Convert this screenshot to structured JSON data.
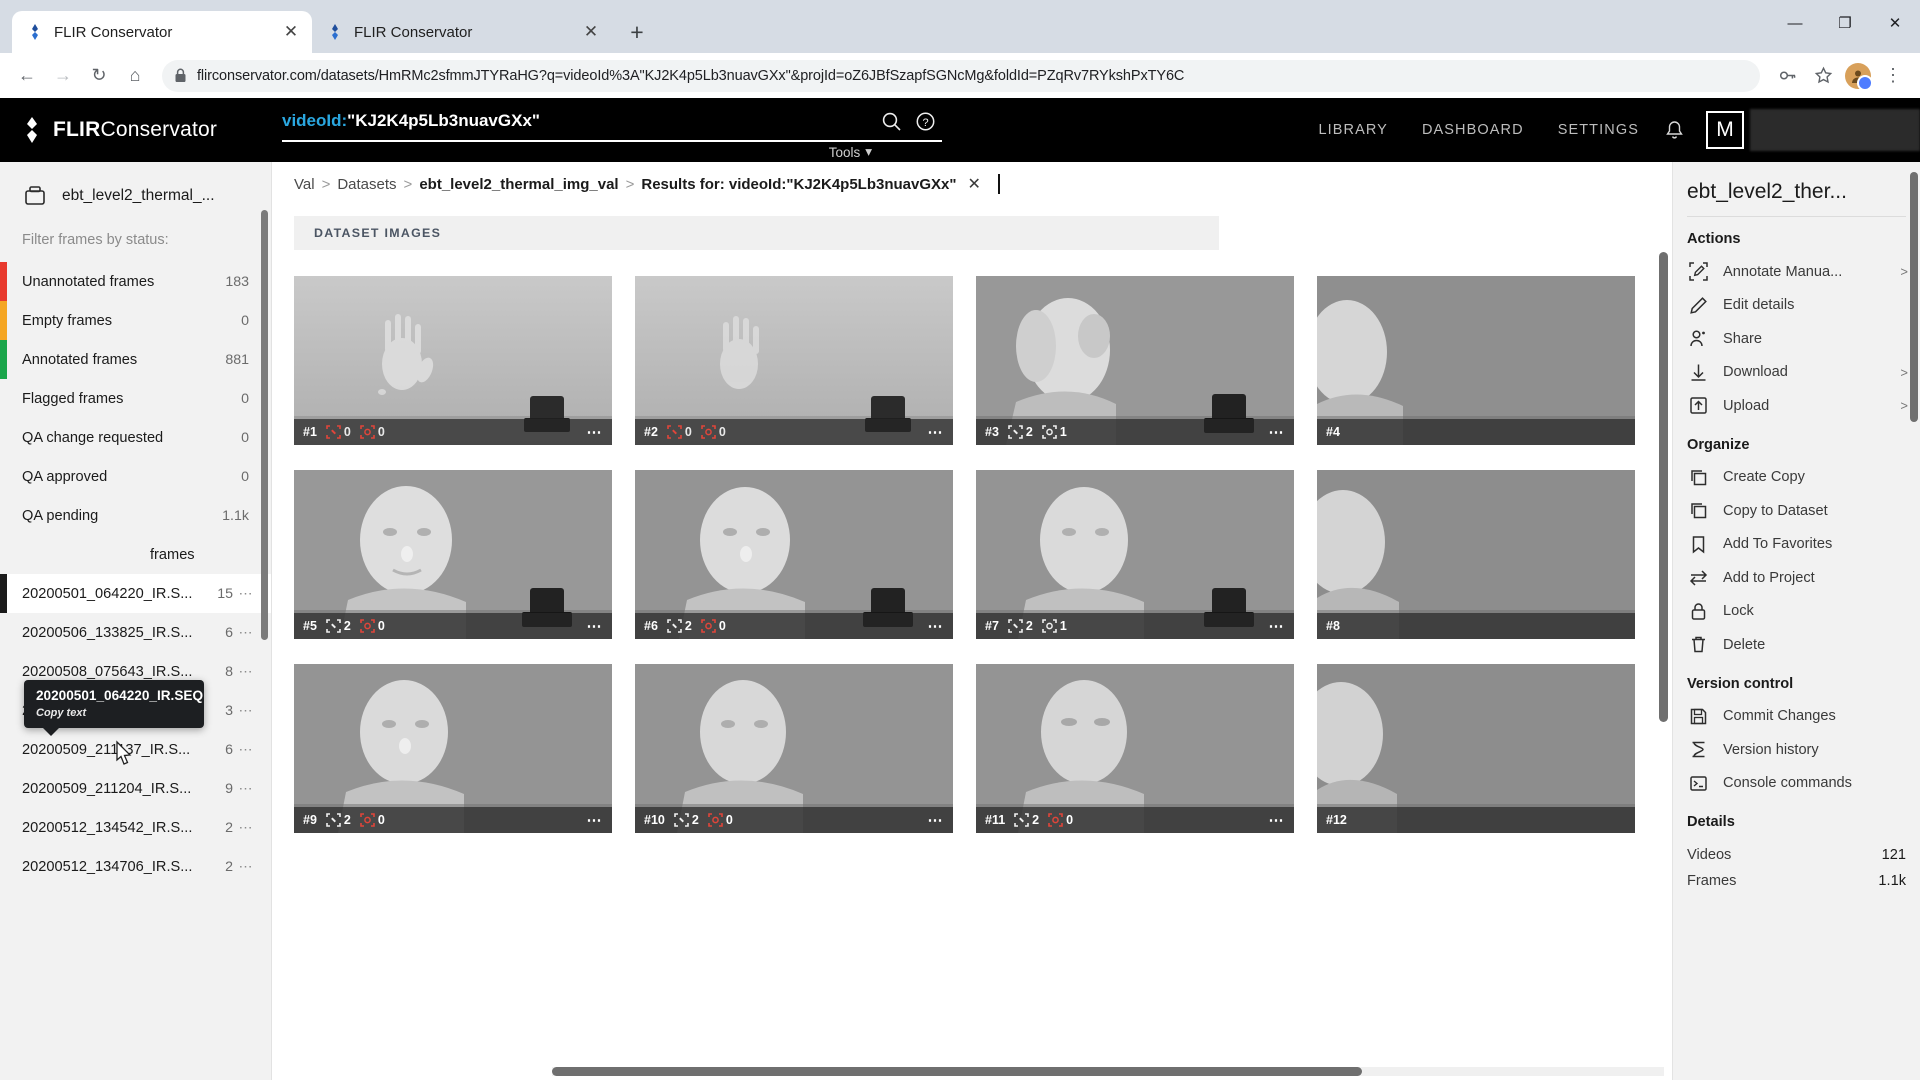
{
  "browser": {
    "tabs": [
      {
        "title": "FLIR Conservator",
        "active": true
      },
      {
        "title": "FLIR Conservator",
        "active": false
      }
    ],
    "new_tab_label": "+",
    "window_controls": {
      "minimize": "—",
      "maximize": "❐",
      "close": "✕"
    },
    "nav": {
      "back": "←",
      "forward": "→",
      "reload": "↻",
      "home": "⌂"
    },
    "url": "flirconservator.com/datasets/HmRMc2sfmmJTYRaHG?q=videoId%3A\"KJ2K4p5Lb3nuavGXx\"&projId=oZ6JBfSzapfSGNcMg&foldId=PZqRv7RYkshPxTY6C",
    "lock_icon": "lock-icon",
    "key_icon": "password-key-icon",
    "star_icon": "bookmark-star-icon",
    "menu_icon": "kebab-menu-icon"
  },
  "appbar": {
    "brand_bold": "FLIR",
    "brand_light": "Conservator",
    "search": {
      "key": "videoId:",
      "value": "\"KJ2K4p5Lb3nuavGXx\""
    },
    "search_icon": "search-icon",
    "help_icon": "help-circle-icon",
    "tools_label": "Tools",
    "nav_links": [
      "LIBRARY",
      "DASHBOARD",
      "SETTINGS"
    ],
    "notification_icon": "bell-icon",
    "user_initial": "M"
  },
  "sidebar": {
    "dataset_name": "ebt_level2_thermal_...",
    "dataset_icon": "dataset-box-icon",
    "filter_label": "Filter frames by status:",
    "filters": [
      {
        "label": "Unannotated frames",
        "count": "183",
        "color": "#e8392d"
      },
      {
        "label": "Empty frames",
        "count": "0",
        "color": "#f5a623"
      },
      {
        "label": "Annotated frames",
        "count": "881",
        "color": "#1aa64b"
      },
      {
        "label": "Flagged frames",
        "count": "0",
        "color": ""
      },
      {
        "label": "QA change requested",
        "count": "0",
        "color": ""
      },
      {
        "label": "QA approved",
        "count": "0",
        "color": ""
      },
      {
        "label": "QA pending",
        "count": "1.1k",
        "color": ""
      },
      {
        "label": "frames",
        "count": "",
        "color": ""
      }
    ],
    "tooltip": {
      "title": "20200501_064220_IR.SEQ",
      "action": "Copy text"
    },
    "sequences": [
      {
        "name": "20200501_064220_IR.S...",
        "count": "15",
        "selected": true
      },
      {
        "name": "20200506_133825_IR.S...",
        "count": "6",
        "selected": false
      },
      {
        "name": "20200508_075643_IR.S...",
        "count": "8",
        "selected": false
      },
      {
        "name": "20200509_211120_IR.S...",
        "count": "3",
        "selected": false
      },
      {
        "name": "20200509_211137_IR.S...",
        "count": "6",
        "selected": false
      },
      {
        "name": "20200509_211204_IR.S...",
        "count": "9",
        "selected": false
      },
      {
        "name": "20200512_134542_IR.S...",
        "count": "2",
        "selected": false
      },
      {
        "name": "20200512_134706_IR.S...",
        "count": "2",
        "selected": false
      }
    ],
    "row_menu_icon": "ellipsis-icon"
  },
  "main": {
    "breadcrumb": [
      {
        "text": "Val",
        "bold": false
      },
      {
        "text": "Datasets",
        "bold": false
      },
      {
        "text": "ebt_level2_thermal_img_val",
        "bold": true
      },
      {
        "text": "Results for: videoId:\"KJ2K4p5Lb3nuavGXx\"",
        "bold": true
      }
    ],
    "breadcrumb_separator": ">",
    "breadcrumb_close_icon": "close-icon",
    "section_title": "DATASET IMAGES",
    "cards": [
      {
        "index": "#1",
        "boxes": "0",
        "polys": "0",
        "scene": "hand",
        "partial": false
      },
      {
        "index": "#2",
        "boxes": "0",
        "polys": "0",
        "scene": "hand",
        "partial": false
      },
      {
        "index": "#3",
        "boxes": "2",
        "polys": "1",
        "scene": "profile",
        "partial": false
      },
      {
        "index": "#4",
        "boxes": "",
        "polys": "",
        "scene": "profile",
        "partial": true
      },
      {
        "index": "#5",
        "boxes": "2",
        "polys": "0",
        "scene": "face",
        "partial": false
      },
      {
        "index": "#6",
        "boxes": "2",
        "polys": "0",
        "scene": "face",
        "partial": false
      },
      {
        "index": "#7",
        "boxes": "2",
        "polys": "1",
        "scene": "face",
        "partial": false
      },
      {
        "index": "#8",
        "boxes": "",
        "polys": "",
        "scene": "face",
        "partial": true
      },
      {
        "index": "#9",
        "boxes": "2",
        "polys": "0",
        "scene": "face",
        "partial": false
      },
      {
        "index": "#10",
        "boxes": "2",
        "polys": "0",
        "scene": "face",
        "partial": false
      },
      {
        "index": "#11",
        "boxes": "2",
        "polys": "0",
        "scene": "face",
        "partial": false
      },
      {
        "index": "#12",
        "boxes": "",
        "polys": "",
        "scene": "face",
        "partial": true
      }
    ],
    "card_menu_icon": "ellipsis-icon",
    "box_badge_icon": "bounding-box-icon",
    "poly_badge_icon": "polygon-box-icon"
  },
  "rightpanel": {
    "title": "ebt_level2_ther...",
    "sections": [
      {
        "heading": "Actions",
        "items": [
          {
            "label": "Annotate Manua...",
            "icon": "annotate-icon",
            "chevron": ">"
          },
          {
            "label": "Edit details",
            "icon": "pencil-icon",
            "chevron": ""
          },
          {
            "label": "Share",
            "icon": "share-user-icon",
            "chevron": ""
          },
          {
            "label": "Download",
            "icon": "download-icon",
            "chevron": ">"
          },
          {
            "label": "Upload",
            "icon": "upload-icon",
            "chevron": ">"
          }
        ]
      },
      {
        "heading": "Organize",
        "items": [
          {
            "label": "Create Copy",
            "icon": "copy-icon",
            "chevron": ""
          },
          {
            "label": "Copy to Dataset",
            "icon": "copy-icon",
            "chevron": ""
          },
          {
            "label": "Add To Favorites",
            "icon": "bookmark-icon",
            "chevron": ""
          },
          {
            "label": "Add to Project",
            "icon": "move-arrows-icon",
            "chevron": ""
          },
          {
            "label": "Lock",
            "icon": "lock-icon",
            "chevron": ""
          },
          {
            "label": "Delete",
            "icon": "trash-icon",
            "chevron": ""
          }
        ]
      },
      {
        "heading": "Version control",
        "items": [
          {
            "label": "Commit Changes",
            "icon": "save-disk-icon",
            "chevron": ""
          },
          {
            "label": "Version history",
            "icon": "history-icon",
            "chevron": ""
          },
          {
            "label": "Console commands",
            "icon": "terminal-icon",
            "chevron": ""
          }
        ]
      }
    ],
    "details_heading": "Details",
    "details": [
      {
        "key": "Videos",
        "value": "121"
      },
      {
        "key": "Frames",
        "value": "1.1k"
      }
    ]
  }
}
